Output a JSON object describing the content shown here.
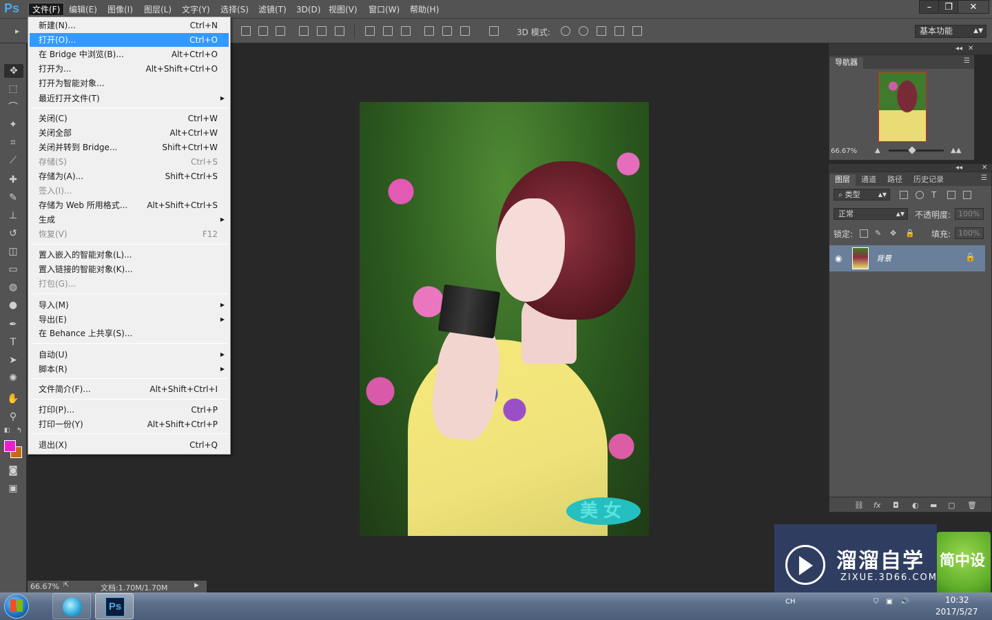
{
  "app": {
    "logo": "Ps"
  },
  "menubar": {
    "items": [
      {
        "label": "文件(F)"
      },
      {
        "label": "编辑(E)"
      },
      {
        "label": "图像(I)"
      },
      {
        "label": "图层(L)"
      },
      {
        "label": "文字(Y)"
      },
      {
        "label": "选择(S)"
      },
      {
        "label": "滤镜(T)"
      },
      {
        "label": "3D(D)"
      },
      {
        "label": "视图(V)"
      },
      {
        "label": "窗口(W)"
      },
      {
        "label": "帮助(H)"
      }
    ],
    "window_controls": {
      "minimize": "–",
      "restore": "❐",
      "close": "✕"
    }
  },
  "options_bar": {
    "mode3d_label": "3D 模式:",
    "workspace": "基本功能"
  },
  "file_menu": {
    "items": [
      {
        "label": "新建(N)...",
        "shortcut": "Ctrl+N"
      },
      {
        "label": "打开(O)...",
        "shortcut": "Ctrl+O"
      },
      {
        "label": "在 Bridge 中浏览(B)...",
        "shortcut": "Alt+Ctrl+O"
      },
      {
        "label": "打开为...",
        "shortcut": "Alt+Shift+Ctrl+O"
      },
      {
        "label": "打开为智能对象...",
        "shortcut": ""
      },
      {
        "label": "最近打开文件(T)",
        "shortcut": ""
      },
      {
        "label": "关闭(C)",
        "shortcut": "Ctrl+W"
      },
      {
        "label": "关闭全部",
        "shortcut": "Alt+Ctrl+W"
      },
      {
        "label": "关闭并转到 Bridge...",
        "shortcut": "Shift+Ctrl+W"
      },
      {
        "label": "存储(S)",
        "shortcut": "Ctrl+S"
      },
      {
        "label": "存储为(A)...",
        "shortcut": "Shift+Ctrl+S"
      },
      {
        "label": "签入(I)...",
        "shortcut": ""
      },
      {
        "label": "存储为 Web 所用格式...",
        "shortcut": "Alt+Shift+Ctrl+S"
      },
      {
        "label": "生成",
        "shortcut": ""
      },
      {
        "label": "恢复(V)",
        "shortcut": "F12"
      },
      {
        "label": "置入嵌入的智能对象(L)...",
        "shortcut": ""
      },
      {
        "label": "置入链接的智能对象(K)...",
        "shortcut": ""
      },
      {
        "label": "打包(G)...",
        "shortcut": ""
      },
      {
        "label": "导入(M)",
        "shortcut": ""
      },
      {
        "label": "导出(E)",
        "shortcut": ""
      },
      {
        "label": "在 Behance 上共享(S)...",
        "shortcut": ""
      },
      {
        "label": "自动(U)",
        "shortcut": ""
      },
      {
        "label": "脚本(R)",
        "shortcut": ""
      },
      {
        "label": "文件简介(F)...",
        "shortcut": "Alt+Shift+Ctrl+I"
      },
      {
        "label": "打印(P)...",
        "shortcut": "Ctrl+P"
      },
      {
        "label": "打印一份(Y)",
        "shortcut": "Alt+Shift+Ctrl+P"
      },
      {
        "label": "退出(X)",
        "shortcut": "Ctrl+Q"
      }
    ],
    "submenu_arrow": "▶"
  },
  "colors": {
    "foreground": "#e61fd0",
    "background": "#c46a1a",
    "highlight": "#3399ff"
  },
  "document": {
    "watermark_text": "美女"
  },
  "navigator": {
    "tab": "导航器",
    "zoom": "66.67%"
  },
  "layers_panel": {
    "tabs": [
      "图层",
      "通道",
      "路径",
      "历史记录"
    ],
    "filter_type": "类型",
    "blend_mode": "正常",
    "opacity_label": "不透明度:",
    "opacity_value": "100%",
    "lock_label": "锁定:",
    "fill_label": "填充:",
    "fill_value": "100%",
    "layer_name": "背景"
  },
  "statusbar": {
    "zoom": "66.67%",
    "doc_info": "文档:1.70M/1.70M"
  },
  "watermark": {
    "title": "溜溜自学",
    "url": "ZIXUE.3D66.COM",
    "tile_text": "简中设"
  },
  "taskbar": {
    "ps_label": "Ps",
    "tray_lang": "CH",
    "time": "10:32",
    "date": "2017/5/27"
  }
}
